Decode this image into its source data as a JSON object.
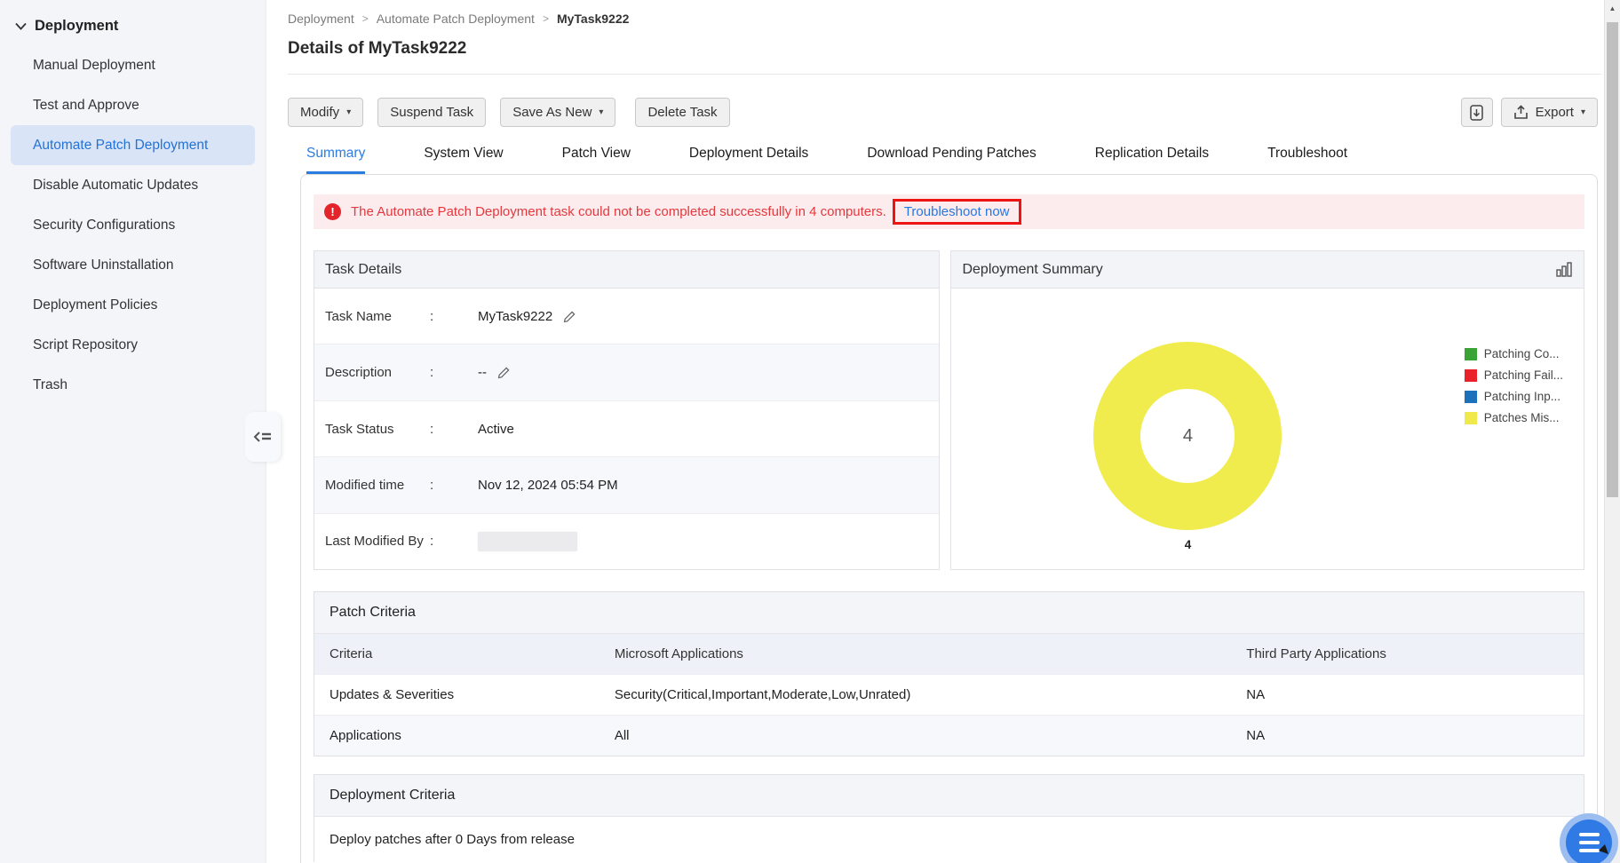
{
  "colors": {
    "accent_blue": "#2b7ce0",
    "alert_red": "#e5383d",
    "alert_box_border": "#ee1414",
    "donut_yellow": "#f0ec4d",
    "sidebar_active_bg": "#d9e5f6"
  },
  "icons": {
    "dropdown_caret": "▾",
    "breadcrumb_separator": ">",
    "scroll_up_arrow": "▲",
    "alert_mark": "!"
  },
  "sidebar": {
    "section_label": "Deployment",
    "items": [
      {
        "label": "Manual Deployment",
        "active": false
      },
      {
        "label": "Test and Approve",
        "active": false
      },
      {
        "label": "Automate Patch Deployment",
        "active": true
      },
      {
        "label": "Disable Automatic Updates",
        "active": false
      },
      {
        "label": "Security Configurations",
        "active": false
      },
      {
        "label": "Software Uninstallation",
        "active": false
      },
      {
        "label": "Deployment Policies",
        "active": false
      },
      {
        "label": "Script Repository",
        "active": false
      },
      {
        "label": "Trash",
        "active": false
      }
    ]
  },
  "breadcrumb": {
    "items": [
      "Deployment",
      "Automate Patch Deployment",
      "MyTask9222"
    ]
  },
  "page": {
    "title": "Details of MyTask9222"
  },
  "toolbar": {
    "modify_label": "Modify",
    "suspend_label": "Suspend Task",
    "save_as_new_label": "Save As New",
    "delete_label": "Delete Task",
    "export_label": "Export"
  },
  "tabs": [
    {
      "label": "Summary",
      "active": true
    },
    {
      "label": "System View",
      "active": false
    },
    {
      "label": "Patch View",
      "active": false
    },
    {
      "label": "Deployment Details",
      "active": false
    },
    {
      "label": "Download Pending Patches",
      "active": false
    },
    {
      "label": "Replication Details",
      "active": false
    },
    {
      "label": "Troubleshoot",
      "active": false
    }
  ],
  "alert": {
    "message": "The Automate Patch Deployment task could not be completed successfully in 4 computers.",
    "link_label": "Troubleshoot now"
  },
  "task_details": {
    "title": "Task Details",
    "colon": ":",
    "rows": [
      {
        "label": "Task Name",
        "value": "MyTask9222"
      },
      {
        "label": "Description",
        "value": "--"
      },
      {
        "label": "Task Status",
        "value": "Active"
      },
      {
        "label": "Modified time",
        "value": "Nov 12, 2024 05:54 PM"
      },
      {
        "label": "Last Modified By",
        "value": ""
      }
    ]
  },
  "deployment_summary": {
    "title": "Deployment Summary",
    "center_value": "4",
    "slice_label": "4",
    "legend": [
      {
        "label": "Patching Co...",
        "color": "#3aa335"
      },
      {
        "label": "Patching Fail...",
        "color": "#e8212a"
      },
      {
        "label": "Patching Inp...",
        "color": "#1d71ba"
      },
      {
        "label": "Patches Mis...",
        "color": "#efe94c"
      }
    ]
  },
  "chart_data": {
    "type": "pie",
    "title": "Deployment Summary",
    "labels": [
      "Patching Co...",
      "Patching Fail...",
      "Patching Inp...",
      "Patches Mis..."
    ],
    "values": [
      0,
      0,
      0,
      4
    ],
    "colors": [
      "#3aa335",
      "#e8212a",
      "#1d71ba",
      "#efe94c"
    ],
    "center_label": "4",
    "slice_label": "4",
    "legend_position": "right",
    "donut": true
  },
  "patch_criteria": {
    "title": "Patch Criteria",
    "headers": [
      "Criteria",
      "Microsoft Applications",
      "Third Party Applications"
    ],
    "rows": [
      [
        "Updates & Severities",
        "Security(Critical,Important,Moderate,Low,Unrated)",
        "NA"
      ],
      [
        "Applications",
        "All",
        "NA"
      ]
    ]
  },
  "deployment_criteria": {
    "title": "Deployment Criteria",
    "text": "Deploy patches after 0 Days from release"
  }
}
